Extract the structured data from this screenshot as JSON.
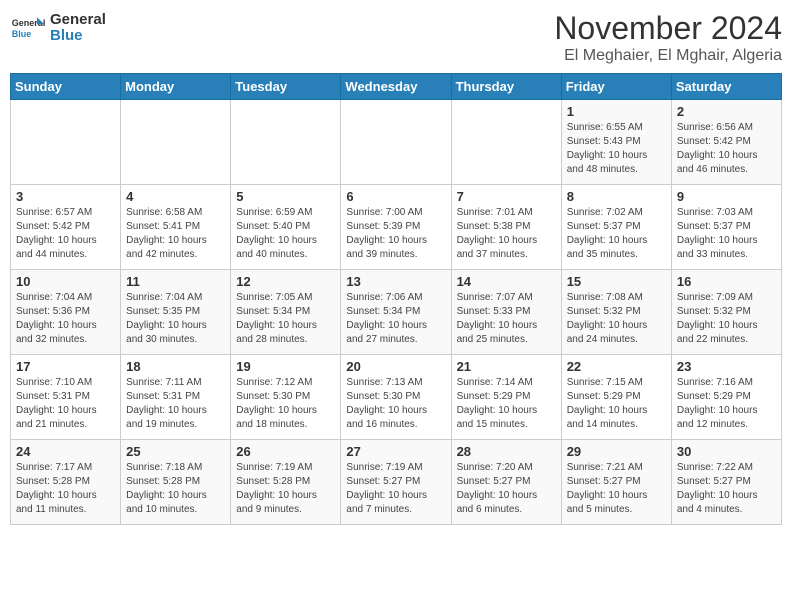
{
  "header": {
    "logo_general": "General",
    "logo_blue": "Blue",
    "month_title": "November 2024",
    "location": "El Meghaier, El Mghair, Algeria"
  },
  "weekdays": [
    "Sunday",
    "Monday",
    "Tuesday",
    "Wednesday",
    "Thursday",
    "Friday",
    "Saturday"
  ],
  "weeks": [
    [
      {
        "day": "",
        "info": ""
      },
      {
        "day": "",
        "info": ""
      },
      {
        "day": "",
        "info": ""
      },
      {
        "day": "",
        "info": ""
      },
      {
        "day": "",
        "info": ""
      },
      {
        "day": "1",
        "info": "Sunrise: 6:55 AM\nSunset: 5:43 PM\nDaylight: 10 hours and 48 minutes."
      },
      {
        "day": "2",
        "info": "Sunrise: 6:56 AM\nSunset: 5:42 PM\nDaylight: 10 hours and 46 minutes."
      }
    ],
    [
      {
        "day": "3",
        "info": "Sunrise: 6:57 AM\nSunset: 5:42 PM\nDaylight: 10 hours and 44 minutes."
      },
      {
        "day": "4",
        "info": "Sunrise: 6:58 AM\nSunset: 5:41 PM\nDaylight: 10 hours and 42 minutes."
      },
      {
        "day": "5",
        "info": "Sunrise: 6:59 AM\nSunset: 5:40 PM\nDaylight: 10 hours and 40 minutes."
      },
      {
        "day": "6",
        "info": "Sunrise: 7:00 AM\nSunset: 5:39 PM\nDaylight: 10 hours and 39 minutes."
      },
      {
        "day": "7",
        "info": "Sunrise: 7:01 AM\nSunset: 5:38 PM\nDaylight: 10 hours and 37 minutes."
      },
      {
        "day": "8",
        "info": "Sunrise: 7:02 AM\nSunset: 5:37 PM\nDaylight: 10 hours and 35 minutes."
      },
      {
        "day": "9",
        "info": "Sunrise: 7:03 AM\nSunset: 5:37 PM\nDaylight: 10 hours and 33 minutes."
      }
    ],
    [
      {
        "day": "10",
        "info": "Sunrise: 7:04 AM\nSunset: 5:36 PM\nDaylight: 10 hours and 32 minutes."
      },
      {
        "day": "11",
        "info": "Sunrise: 7:04 AM\nSunset: 5:35 PM\nDaylight: 10 hours and 30 minutes."
      },
      {
        "day": "12",
        "info": "Sunrise: 7:05 AM\nSunset: 5:34 PM\nDaylight: 10 hours and 28 minutes."
      },
      {
        "day": "13",
        "info": "Sunrise: 7:06 AM\nSunset: 5:34 PM\nDaylight: 10 hours and 27 minutes."
      },
      {
        "day": "14",
        "info": "Sunrise: 7:07 AM\nSunset: 5:33 PM\nDaylight: 10 hours and 25 minutes."
      },
      {
        "day": "15",
        "info": "Sunrise: 7:08 AM\nSunset: 5:32 PM\nDaylight: 10 hours and 24 minutes."
      },
      {
        "day": "16",
        "info": "Sunrise: 7:09 AM\nSunset: 5:32 PM\nDaylight: 10 hours and 22 minutes."
      }
    ],
    [
      {
        "day": "17",
        "info": "Sunrise: 7:10 AM\nSunset: 5:31 PM\nDaylight: 10 hours and 21 minutes."
      },
      {
        "day": "18",
        "info": "Sunrise: 7:11 AM\nSunset: 5:31 PM\nDaylight: 10 hours and 19 minutes."
      },
      {
        "day": "19",
        "info": "Sunrise: 7:12 AM\nSunset: 5:30 PM\nDaylight: 10 hours and 18 minutes."
      },
      {
        "day": "20",
        "info": "Sunrise: 7:13 AM\nSunset: 5:30 PM\nDaylight: 10 hours and 16 minutes."
      },
      {
        "day": "21",
        "info": "Sunrise: 7:14 AM\nSunset: 5:29 PM\nDaylight: 10 hours and 15 minutes."
      },
      {
        "day": "22",
        "info": "Sunrise: 7:15 AM\nSunset: 5:29 PM\nDaylight: 10 hours and 14 minutes."
      },
      {
        "day": "23",
        "info": "Sunrise: 7:16 AM\nSunset: 5:29 PM\nDaylight: 10 hours and 12 minutes."
      }
    ],
    [
      {
        "day": "24",
        "info": "Sunrise: 7:17 AM\nSunset: 5:28 PM\nDaylight: 10 hours and 11 minutes."
      },
      {
        "day": "25",
        "info": "Sunrise: 7:18 AM\nSunset: 5:28 PM\nDaylight: 10 hours and 10 minutes."
      },
      {
        "day": "26",
        "info": "Sunrise: 7:19 AM\nSunset: 5:28 PM\nDaylight: 10 hours and 9 minutes."
      },
      {
        "day": "27",
        "info": "Sunrise: 7:19 AM\nSunset: 5:27 PM\nDaylight: 10 hours and 7 minutes."
      },
      {
        "day": "28",
        "info": "Sunrise: 7:20 AM\nSunset: 5:27 PM\nDaylight: 10 hours and 6 minutes."
      },
      {
        "day": "29",
        "info": "Sunrise: 7:21 AM\nSunset: 5:27 PM\nDaylight: 10 hours and 5 minutes."
      },
      {
        "day": "30",
        "info": "Sunrise: 7:22 AM\nSunset: 5:27 PM\nDaylight: 10 hours and 4 minutes."
      }
    ]
  ]
}
